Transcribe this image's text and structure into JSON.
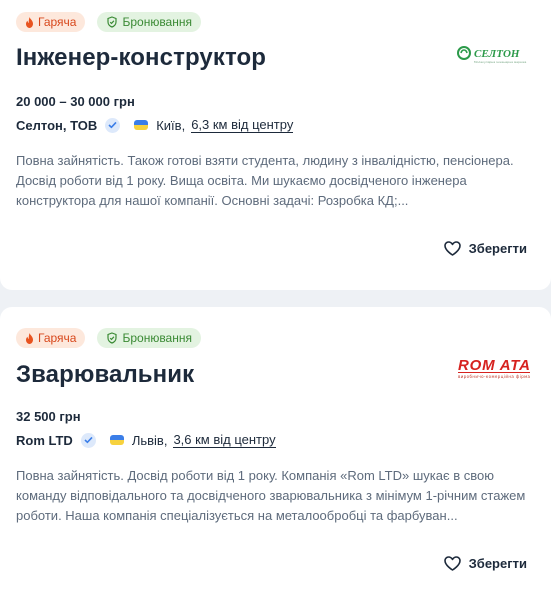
{
  "vacancies": [
    {
      "badges": {
        "hot": "Гаряча",
        "booking": "Бронювання"
      },
      "title": "Інженер-конструктор",
      "logo_text": "СЕЛТОН",
      "logo_subtext": "Молекулярна інженерна мережа",
      "salary": "20 000 – 30 000 грн",
      "company": "Селтон, ТОВ",
      "city": "Київ,",
      "distance": "6,3 км від центру",
      "description": "Повна зайнятість. Також готові взяти студента, людину з інвалідністю, пенсіонера. Досвід роботи від 1 року. Вища освіта. Ми шукаємо досвідченого інженера конструктора для нашої компанії. Основні задачі: Розробка КД;...",
      "save_label": "Зберегти"
    },
    {
      "badges": {
        "hot": "Гаряча",
        "booking": "Бронювання"
      },
      "title": "Зварювальник",
      "logo_text": "ROM ATA",
      "logo_subtext": "виробничо-комерційна фірма",
      "salary": "32 500 грн",
      "company": "Rom LTD",
      "city": "Львів,",
      "distance": "3,6 км від центру",
      "description": "Повна зайнятість. Досвід роботи від 1 року. Компанія «Rom LTD» шукає в свою команду відповідального та досвідченого зварювальника з мінімум 1-річним стажем роботи. Наша компанія спеціалізується на металообробці та фарбуван...",
      "save_label": "Зберегти"
    }
  ],
  "colors": {
    "hot_bg": "#fde8dc",
    "hot_text": "#d8481c",
    "booking_bg": "#e3f3e1",
    "booking_text": "#3a8a34",
    "logo1": "#2c9a4a",
    "logo2": "#d6221f"
  },
  "icons": [
    "fire-icon",
    "shield-check-icon",
    "verified-icon",
    "ukraine-flag-icon",
    "heart-icon"
  ]
}
